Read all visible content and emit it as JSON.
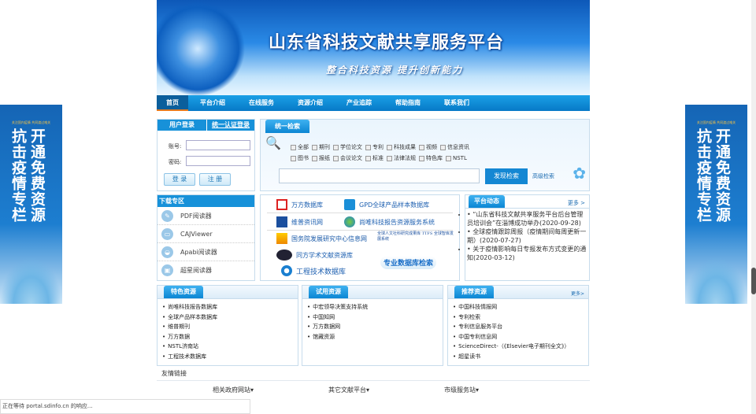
{
  "banner": {
    "title": "山东省科技文献共享服务平台",
    "slogan": "整合科技资源 提升创新能力"
  },
  "nav": [
    "首页",
    "平台介绍",
    "在线服务",
    "资源介绍",
    "产业追踪",
    "帮助指南",
    "联系我们"
  ],
  "login": {
    "tab1": "用户登录",
    "tab2": "统一认证登录",
    "account_label": "账号:",
    "password_label": "密码:",
    "login_btn": "登 录",
    "register_btn": "注 册"
  },
  "search": {
    "tab": "统一检索",
    "options_row1": [
      "全部",
      "期刊",
      "学位论文",
      "专利",
      "科技成果",
      "视频",
      "信息资讯"
    ],
    "options_row2": [
      "图书",
      "报纸",
      "会议论文",
      "标准",
      "法律法规",
      "特色库",
      "NSTL"
    ],
    "query": "",
    "search_btn": "发现检索",
    "advanced": "高级检索"
  },
  "downloads": {
    "title": "下载专区",
    "items": [
      "PDF阅读器",
      "CAJViewer",
      "Apabi阅读器",
      "超星阅读器"
    ]
  },
  "databases": [
    "万方数据库",
    "GPD全球产品样本数据库",
    "维普资讯网",
    "尚唯科技报告资源服务系统",
    "国务院发展研究中心信息网",
    "全球人文社科研究成果库 TTFS 全球智库发展系统",
    "同方学术文献资源库",
    "工程技术数据库",
    "专业数据库检索"
  ],
  "news": {
    "title": "平台动态",
    "more": "更多 >",
    "items": [
      {
        "text": "“山东省科技文献共享服务平台后台管理员培训会”在淄博成功举办",
        "date": "(2020-09-28)"
      },
      {
        "text": "全球疫情跟踪周报（疫情期间每周更新一期）",
        "date": "(2020-07-27)"
      },
      {
        "text": "关于疫情影响每日专报发布方式变更的通知",
        "date": "(2020-03-12)"
      }
    ]
  },
  "featured": {
    "title": "特色资源",
    "items": [
      "尚唯科技报告数据库",
      "全球产品样本数据库",
      "维普期刊",
      "万方数据",
      "NSTL济南站",
      "工程技术数据库"
    ]
  },
  "trial": {
    "title": "试用资源",
    "items": [
      "中宏领导决策支持系统",
      "中国知网",
      "万方数据网",
      "馆藏资源"
    ]
  },
  "recommended": {
    "title": "推荐资源",
    "more": "更多>",
    "items": [
      "中国科技情报网",
      "专利检索",
      "专利信息服务平台",
      "中国专利信息网",
      "ScienceDirect-（《Elsevier电子期刊全文》）",
      "超星读书"
    ]
  },
  "links": {
    "title": "友情链接",
    "selects": [
      "相关政府网站",
      "其它文献平台",
      "市级服务站"
    ]
  },
  "side_banner": {
    "col1": "抗击疫情专栏",
    "col2": "开通免费资源",
    "top": "关注国内疫情 共同渡过难关"
  },
  "status": "正在等待 portal.sdinfo.cn 的响应..."
}
